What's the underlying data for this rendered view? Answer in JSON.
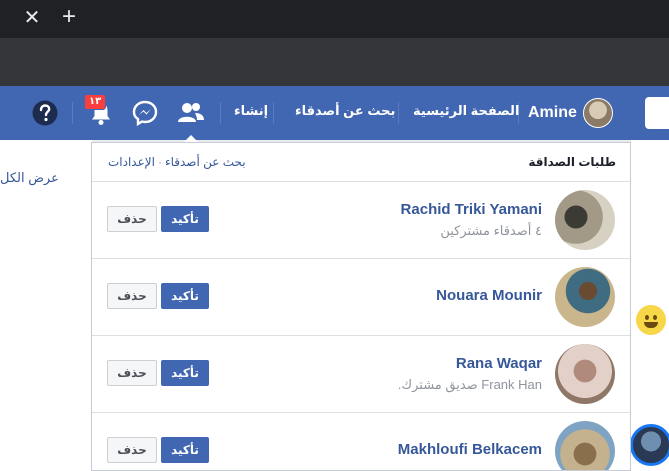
{
  "browser": {
    "close_tab_glyph": "✕",
    "new_tab_glyph": "+"
  },
  "header": {
    "user_name": "Amine",
    "nav_home": "الصفحة الرئيسية",
    "nav_find_friends": "بحث عن أصدقاء",
    "nav_create": "إنشاء",
    "notification_count": "١٣",
    "icons": [
      "friends-icon",
      "messenger-icon",
      "notifications-icon",
      "help-icon"
    ]
  },
  "background": {
    "left_link": "عرض الكل"
  },
  "friend_requests": {
    "title": "طلبات الصداقة",
    "link_find": "بحث عن أصدقاء",
    "link_separator": "·",
    "link_settings": "الإعدادات",
    "confirm_label": "تأكيد",
    "delete_label": "حذف",
    "items": [
      {
        "name": "Rachid Triki Yamani",
        "subtitle": "٤ أصدقاء مشتركين"
      },
      {
        "name": "Nouara Mounir",
        "subtitle": ""
      },
      {
        "name": "Rana Waqar",
        "subtitle": "Frank Han صديق مشترك."
      },
      {
        "name": "Makhloufi Belkacem",
        "subtitle": ""
      }
    ]
  },
  "colors": {
    "brand": "#4267b2",
    "link": "#365899",
    "badge": "#fa3e3e",
    "chrome": "#202124"
  }
}
